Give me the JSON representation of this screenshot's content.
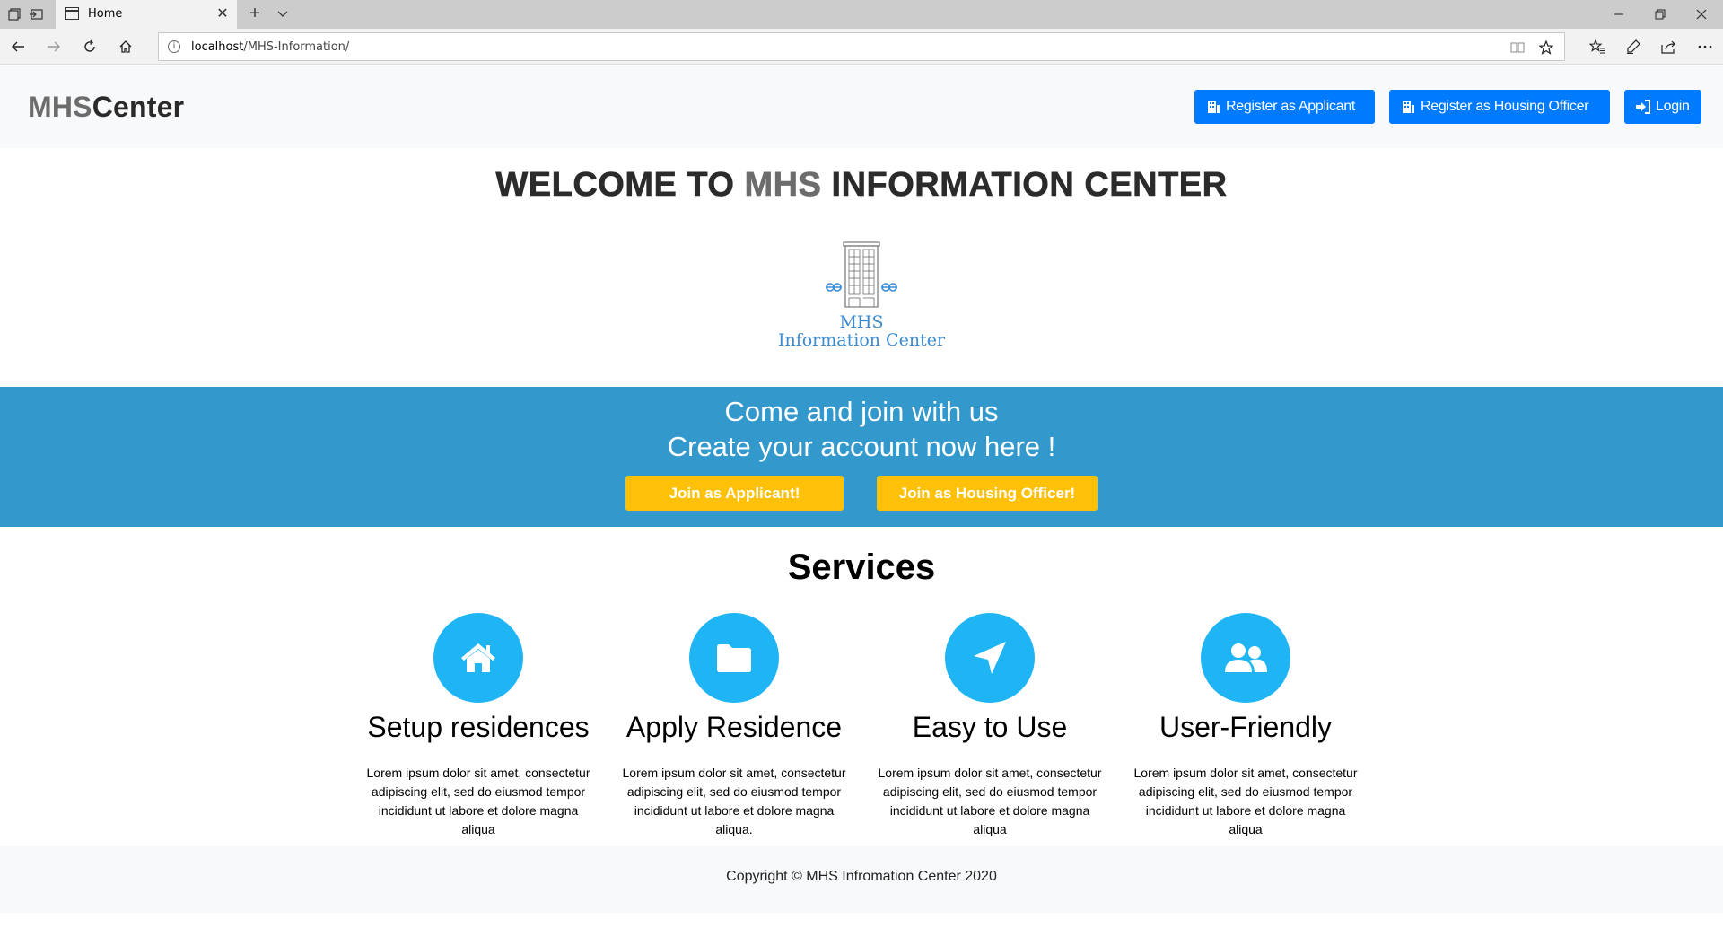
{
  "browser": {
    "tab_title": "Home",
    "url_host": "localhost",
    "url_path": "/MHS-Information/"
  },
  "header": {
    "brand_part1": "MHS",
    "brand_part2": "Center",
    "buttons": {
      "register_applicant": "Register as Applicant",
      "register_officer": "Register as Housing Officer",
      "login": "Login"
    }
  },
  "welcome": {
    "prefix": "WELCOME TO ",
    "highlight": "MHS",
    "suffix": " INFORMATION CENTER"
  },
  "logo": {
    "line1": "MHS",
    "line2": "Information Center"
  },
  "banner": {
    "line1": "Come and join with us",
    "line2": "Create your account now here !",
    "join_applicant": "Join as Applicant!",
    "join_officer": "Join as Housing Officer!"
  },
  "services": {
    "title": "Services",
    "items": [
      {
        "icon": "home-icon",
        "title": "Setup residences",
        "desc": "Lorem ipsum dolor sit amet, consectetur adipiscing elit, sed do eiusmod tempor incididunt ut labore et dolore magna aliqua"
      },
      {
        "icon": "folder-icon",
        "title": "Apply Residence",
        "desc": "Lorem ipsum dolor sit amet, consectetur adipiscing elit, sed do eiusmod tempor incididunt ut labore et dolore magna aliqua."
      },
      {
        "icon": "paper-plane-icon",
        "title": "Easy to Use",
        "desc": "Lorem ipsum dolor sit amet, consectetur adipiscing elit, sed do eiusmod tempor incididunt ut labore et dolore magna aliqua"
      },
      {
        "icon": "users-icon",
        "title": "User-Friendly",
        "desc": "Lorem ipsum dolor sit amet, consectetur adipiscing elit, sed do eiusmod tempor incididunt ut labore et dolore magna aliqua"
      }
    ]
  },
  "footer": {
    "text": "Copyright © MHS Infromation Center 2020"
  },
  "colors": {
    "primary_button": "#007bff",
    "banner": "#3399cc",
    "join_button": "#ffc107",
    "service_circle": "#1fb5f5"
  }
}
